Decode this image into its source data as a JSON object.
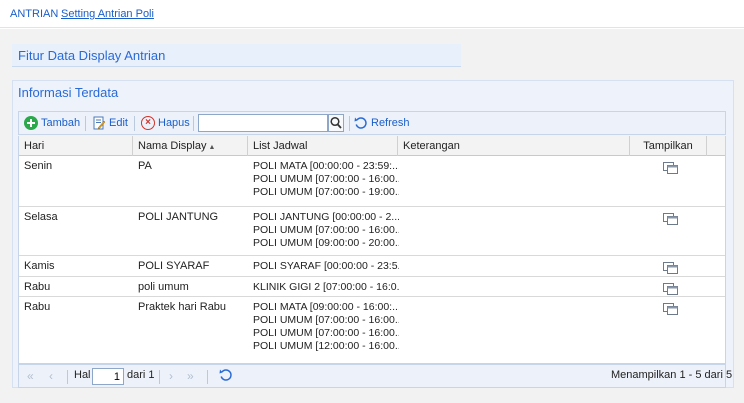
{
  "breadcrumb": {
    "root": "ANTRIAN",
    "current": "Setting Antrian Poli"
  },
  "feature_panel": {
    "title": "Fitur Data Display Antrian"
  },
  "info_panel": {
    "title": "Informasi Terdata"
  },
  "toolbar": {
    "add_label": "Tambah",
    "edit_label": "Edit",
    "delete_label": "Hapus",
    "search_value": "",
    "refresh_label": "Refresh"
  },
  "table": {
    "columns": [
      "Hari",
      "Nama Display",
      "List Jadwal",
      "Keterangan",
      "Tampilkan"
    ],
    "rows": [
      {
        "hari": "Senin",
        "nama": "PA",
        "jadwal": [
          "POLI MATA [00:00:00 - 23:59:...",
          "POLI UMUM [07:00:00 - 16:00...",
          "POLI UMUM [07:00:00 - 19:00..."
        ],
        "keterangan": ""
      },
      {
        "hari": "Selasa",
        "nama": "POLI JANTUNG",
        "jadwal": [
          "POLI JANTUNG [00:00:00 - 2...",
          "POLI UMUM [07:00:00 - 16:00...",
          "POLI UMUM [09:00:00 - 20:00..."
        ],
        "keterangan": ""
      },
      {
        "hari": "Kamis",
        "nama": "POLI SYARAF",
        "jadwal": [
          "POLI SYARAF [00:00:00 - 23:5..."
        ],
        "keterangan": ""
      },
      {
        "hari": "Rabu",
        "nama": "poli umum",
        "jadwal": [
          "KLINIK GIGI 2 [07:00:00 - 16:0..."
        ],
        "keterangan": ""
      },
      {
        "hari": "Rabu",
        "nama": "Praktek hari Rabu",
        "jadwal": [
          "POLI MATA [09:00:00 - 16:00:...",
          "POLI UMUM [07:00:00 - 16:00...",
          "POLI UMUM [07:00:00 - 16:00...",
          "POLI UMUM [12:00:00 - 16:00..."
        ],
        "keterangan": ""
      }
    ]
  },
  "pager": {
    "page_label": "Hal",
    "page_value": "1",
    "of_label": "dari 1",
    "summary": "Menampilkan 1 - 5 dari 5"
  },
  "icons": {
    "add": "plus-circle-icon",
    "edit": "edit-icon",
    "delete": "x-circle-icon",
    "search": "magnifier-icon",
    "refresh": "refresh-icon",
    "view": "window-icon"
  },
  "colors": {
    "accent": "#1a5ec9",
    "panel_bg": "#eef3fb",
    "add_green": "#2aa84a",
    "delete_red": "#d0342c"
  }
}
